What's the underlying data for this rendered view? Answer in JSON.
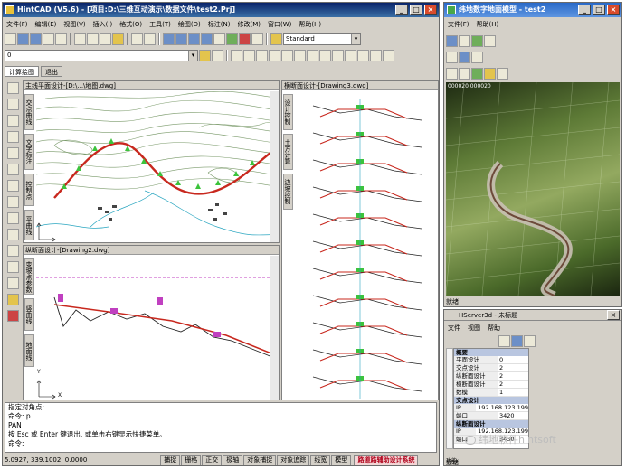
{
  "main_window": {
    "title": "HintCAD (V5.6) - [项目:D:\\三维互动演示\\数据文件\\test2.Prj]",
    "menu": [
      "文件(F)",
      "编辑(E)",
      "视图(V)",
      "插入(I)",
      "格式(O)",
      "工具(T)",
      "绘图(D)",
      "标注(N)",
      "修改(M)",
      "窗口(W)",
      "帮助(H)"
    ],
    "style_combo": "Standard",
    "layer_combo": "0",
    "sub_tabs": [
      "计算绘图",
      "退出"
    ],
    "plan_pane_title": "主线平面设计-[D:\\...\\地图.dwg]",
    "profile_pane_title": "纵断面设计-[Drawing2.dwg]",
    "cross_pane_title": "横断面设计-[Drawing3.dwg]",
    "plan_vtabs": [
      "交点曲线",
      "文字标注",
      "控制点",
      "平曲线"
    ],
    "profile_vtabs": [
      "变坡点参数",
      "竖曲线",
      "地面线"
    ],
    "cross_vtabs": [
      "设计控制",
      "土方计算",
      "边坡控制"
    ],
    "command_lines": [
      "指定对角点:",
      "命令: p",
      "PAN",
      "按 Esc 或 Enter 键退出, 或单击右键显示快捷菜单。",
      "命令:"
    ],
    "status_coords": "5.0927, 339.1002, 0.0000",
    "status_cells": [
      "捕捉",
      "栅格",
      "正交",
      "极轴",
      "对象捕捉",
      "对象追踪",
      "线宽",
      "模型"
    ],
    "status_brand": "路道路辅助设计系统",
    "y_axis": "Y",
    "x_axis": "X"
  },
  "model_window": {
    "title": "纬地数字地面模型 - test2",
    "menu": [
      "文件(F)",
      "帮助(H)"
    ],
    "coords": "000020 000020"
  },
  "server_window": {
    "title_label": "HServer3d - 未标题",
    "menu": [
      "文件",
      "视图",
      "帮助"
    ],
    "rows": [
      {
        "type": "head",
        "text": "概要"
      },
      {
        "k": "平面设计",
        "v": "0"
      },
      {
        "k": "交点设计",
        "v": "2"
      },
      {
        "k": "纵断面设计",
        "v": "2"
      },
      {
        "k": "横断面设计",
        "v": "2"
      },
      {
        "k": "数模",
        "v": "1"
      },
      {
        "type": "head",
        "text": "交点设计"
      },
      {
        "k": "IP",
        "v": "192.168.123.199"
      },
      {
        "k": "端口",
        "v": "3420"
      },
      {
        "type": "head",
        "text": "纵断面设计"
      },
      {
        "k": "IP",
        "v": "192.168.123.199"
      },
      {
        "k": "端口",
        "v": "3430"
      }
    ],
    "side_label": "功能",
    "status": "就绪"
  },
  "watermark": "纬地软件hintsoft",
  "colors": {
    "title": "#0a246a",
    "road": "#c8281e",
    "contour": "#7a9a6a",
    "grade": "#8a1a8a",
    "marker": "#c040c0"
  }
}
